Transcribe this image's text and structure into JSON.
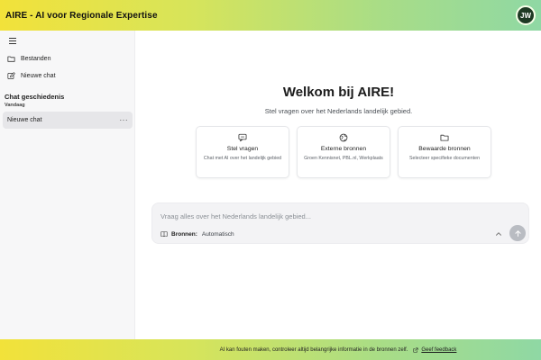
{
  "header": {
    "app_title": "AIRE - AI voor Regionale Expertise",
    "avatar_initials": "JW"
  },
  "sidebar": {
    "menu_icon": "hamburger-icon",
    "links": [
      {
        "label": "Bestanden",
        "icon": "folder-icon"
      },
      {
        "label": "Nieuwe chat",
        "icon": "edit-icon"
      }
    ],
    "history_title": "Chat geschiedenis",
    "history_group": "Vandaag",
    "chats": [
      {
        "label": "Nieuwe chat",
        "more": "···"
      }
    ]
  },
  "main": {
    "welcome_title": "Welkom bij AIRE!",
    "subtitle": "Stel vragen over het Nederlands landelijk gebied.",
    "cards": [
      {
        "icon": "chat-bubble-icon",
        "title": "Stel vragen",
        "description": "Chat met AI over het landelijk gebied"
      },
      {
        "icon": "globe-icon",
        "title": "Externe bronnen",
        "description": "Groen Kennisnet, PBL.nl, Werkplaats"
      },
      {
        "icon": "folder-icon",
        "title": "Bewaarde bronnen",
        "description": "Selecteer specifieke documenten"
      }
    ],
    "composer": {
      "placeholder": "Vraag alles over het Nederlands landelijk gebied...",
      "sources_label": "Bronnen:",
      "sources_value": "Automatisch"
    }
  },
  "footer": {
    "disclaimer": "AI kan fouten maken, controleer altijd belangrijke informatie in de bronnen zelf.",
    "feedback_label": "Geef feedback"
  },
  "colors": {
    "gradient_start": "#f2e23a",
    "gradient_end": "#8fd8a4",
    "avatar_bg": "#1e3a24",
    "active_chat_bg": "#e6e6e9"
  }
}
